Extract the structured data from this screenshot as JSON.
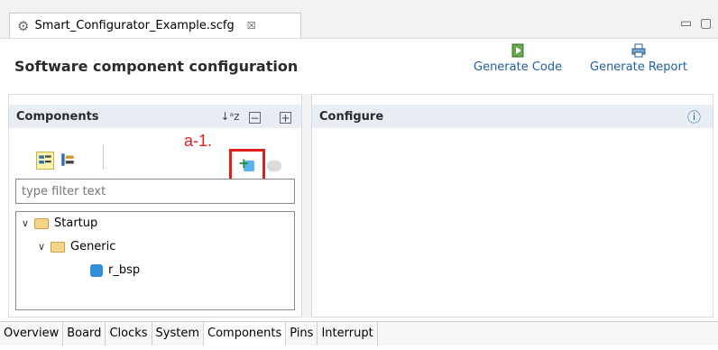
{
  "editor": {
    "tab_title": "Smart_Configurator_Example.scfg",
    "close_glyph": "☒",
    "minimize_glyph": "▭",
    "maximize_glyph": "▢"
  },
  "header": {
    "title": "Software component configuration",
    "generate_code": "Generate Code",
    "generate_report": "Generate Report"
  },
  "components_panel": {
    "title": "Components",
    "filter_placeholder": "type filter text",
    "annotation": "a-1.",
    "tree": [
      {
        "label": "Startup",
        "level": 0,
        "expanded": true
      },
      {
        "label": "Generic",
        "level": 1,
        "expanded": true
      },
      {
        "label": "r_bsp",
        "level": 2
      }
    ]
  },
  "configure_panel": {
    "title": "Configure",
    "info_glyph": "ⓘ"
  },
  "bottom_tabs": [
    "Overview",
    "Board",
    "Clocks",
    "System",
    "Components",
    "Pins",
    "Interrupt"
  ],
  "active_bottom_tab": "Components",
  "colors": {
    "annotation": "#e02020",
    "link": "#1f5f9f",
    "panel_header": "#e8eef4"
  }
}
